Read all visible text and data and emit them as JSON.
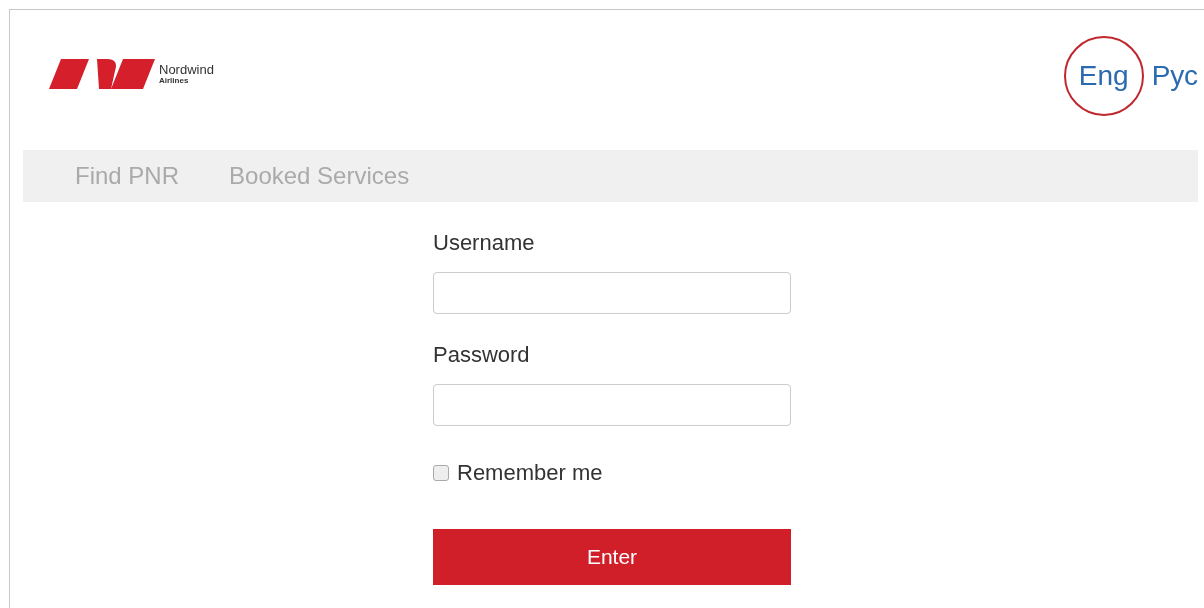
{
  "logo": {
    "name": "Nordwind",
    "tagline": "Airlines"
  },
  "languages": [
    {
      "label": "Eng",
      "selected": true
    },
    {
      "label": "Рус",
      "selected": false
    }
  ],
  "nav": [
    {
      "label": "Find PNR"
    },
    {
      "label": "Booked Services"
    }
  ],
  "form": {
    "fields": [
      {
        "label": "Username"
      },
      {
        "label": "Password"
      }
    ],
    "remember": {
      "label": "Remember me",
      "checked": false
    },
    "submit": "Enter"
  }
}
